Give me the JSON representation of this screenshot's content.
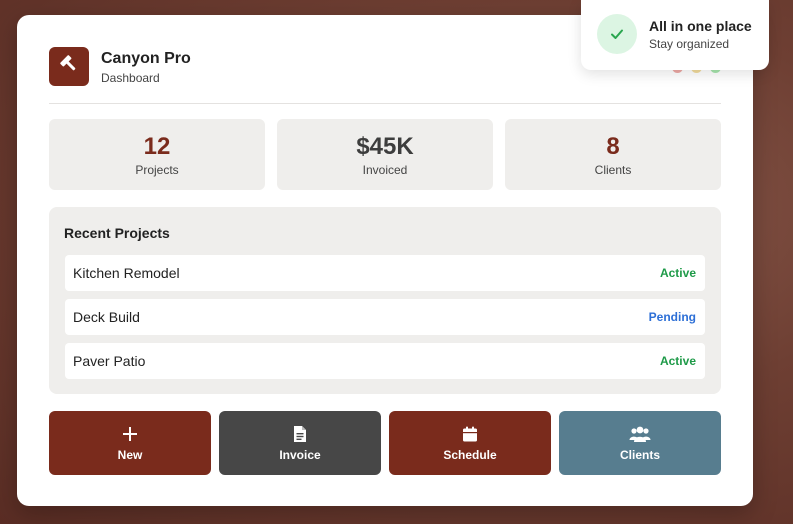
{
  "app": {
    "title": "Canyon Pro",
    "subtitle": "Dashboard",
    "logo_icon": "hammer-icon",
    "window_controls": [
      "#e0625b",
      "#e8c04a",
      "#5fcf6a"
    ]
  },
  "stats": [
    {
      "value": "12",
      "label": "Projects",
      "color": "#7a2b1c"
    },
    {
      "value": "$45K",
      "label": "Invoiced",
      "color": "#3d3d3d"
    },
    {
      "value": "8",
      "label": "Clients",
      "color": "#7a2b1c"
    }
  ],
  "recent": {
    "title": "Recent Projects",
    "projects": [
      {
        "name": "Kitchen Remodel",
        "status": "Active",
        "status_color": "#1e9a48"
      },
      {
        "name": "Deck Build",
        "status": "Pending",
        "status_color": "#2d6fd6"
      },
      {
        "name": "Paver Patio",
        "status": "Active",
        "status_color": "#1e9a48"
      }
    ]
  },
  "actions": [
    {
      "label": "New",
      "icon": "plus-icon",
      "color": "#7a2b1c"
    },
    {
      "label": "Invoice",
      "icon": "document-icon",
      "color": "#474747"
    },
    {
      "label": "Schedule",
      "icon": "calendar-icon",
      "color": "#7a2b1c"
    },
    {
      "label": "Clients",
      "icon": "users-icon",
      "color": "#577d8f"
    }
  ],
  "toast": {
    "title": "All in one place",
    "subtitle": "Stay organized",
    "icon": "check-icon",
    "icon_color": "#2aa64f"
  }
}
